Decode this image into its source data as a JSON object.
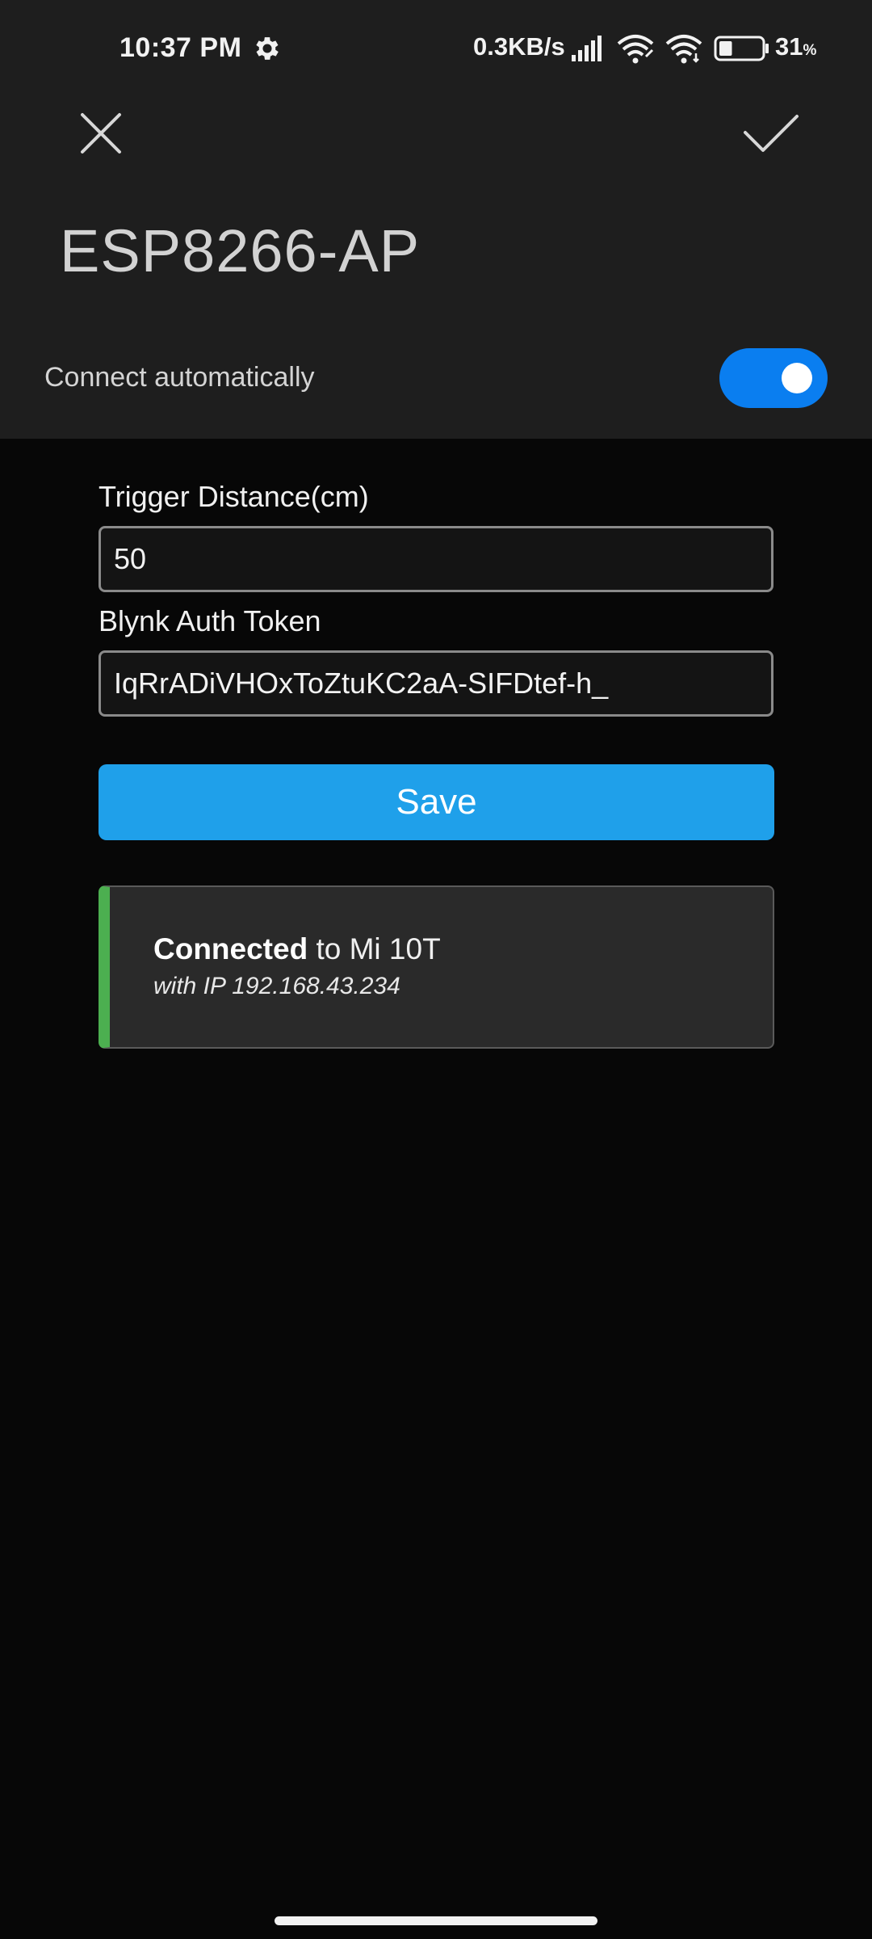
{
  "status_bar": {
    "time": "10:37 PM",
    "network_speed": "0.3KB/s",
    "battery_percent": "31",
    "battery_unit": "%",
    "battery_level": 0.31,
    "icons": [
      "gear-icon",
      "signal-icon",
      "wifi-icon",
      "wifi-icon",
      "battery-icon"
    ]
  },
  "header": {
    "close_icon": "close-icon",
    "confirm_icon": "check-icon",
    "network_name": "ESP8266-AP"
  },
  "auto_connect": {
    "label": "Connect automatically",
    "enabled": true,
    "accent_color": "#0a7ef0"
  },
  "form": {
    "trigger_distance": {
      "label": "Trigger Distance(cm)",
      "value": "50"
    },
    "auth_token": {
      "label": "Blynk Auth Token",
      "value": "IqRrADiVHOxToZtuKC2aA-SIFDtef-h_"
    },
    "save_label": "Save",
    "save_color": "#1fa0ea"
  },
  "connection_status": {
    "state": "Connected",
    "to_text": " to Mi 10T",
    "ip_text": "with IP 192.168.43.234",
    "accent_color": "#4caf50"
  }
}
